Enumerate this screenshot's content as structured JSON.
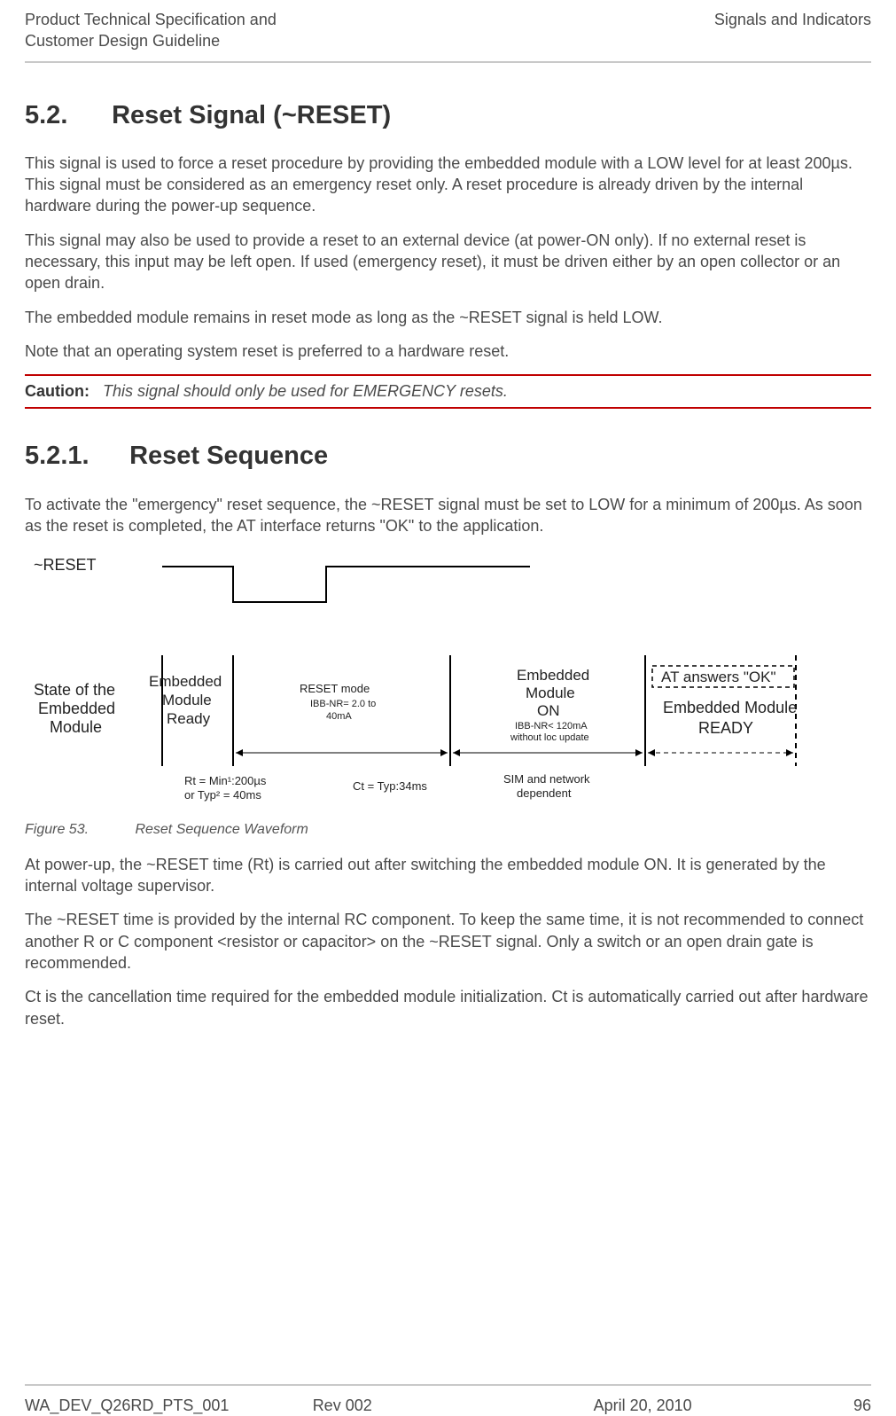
{
  "header": {
    "left_line1": "Product Technical Specification and",
    "left_line2": "Customer Design Guideline",
    "right": "Signals and Indicators"
  },
  "section": {
    "number": "5.2.",
    "title": "Reset Signal (~RESET)",
    "paragraphs": [
      "This signal is used to force a reset procedure by providing the embedded module with a LOW level for at least 200µs. This signal must be considered as an emergency reset only. A reset procedure is already driven by the internal hardware during the power-up sequence.",
      "This signal may also be used to provide a reset to an external device (at power-ON only). If no external reset is necessary, this input may be left open. If used (emergency reset), it must be driven either by an open collector or an open drain.",
      "The embedded module remains in reset mode as long as the ~RESET signal is held LOW.",
      "Note that an operating system reset is preferred to a hardware reset."
    ]
  },
  "caution": {
    "label": "Caution:",
    "text": "This signal should only be used for EMERGENCY resets."
  },
  "subsection": {
    "number": "5.2.1.",
    "title": "Reset Sequence",
    "intro": "To activate the \"emergency\" reset sequence, the ~RESET signal must be set to LOW for a minimum of 200µs. As soon as the reset is completed, the AT interface returns \"OK\" to the application."
  },
  "figure": {
    "number": "Figure 53.",
    "caption": "Reset Sequence Waveform",
    "labels": {
      "reset_signal": "~RESET",
      "state_label_l1": "State of the",
      "state_label_l2": "Embedded",
      "state_label_l3": "Module",
      "state1_l1": "Embedded",
      "state1_l2": "Module",
      "state1_l3": "Ready",
      "state2_l1": "RESET mode",
      "state2_l2": "IBB-NR= 2.0 to",
      "state2_l3": "40mA",
      "state3_l1": "Embedded",
      "state3_l2": "Module",
      "state3_l3": "ON",
      "state3_l4": "IBB-NR< 120mA",
      "state3_l5": "without loc update",
      "state4_l1": "AT answers \"OK\"",
      "state4_l2": "Embedded Module",
      "state4_l3": "READY",
      "rt_l1": "Rt = Min¹:200µs",
      "rt_l2": "or Typ² = 40ms",
      "ct": "Ct =  Typ:34ms",
      "sim_l1": "SIM and network",
      "sim_l2": "dependent"
    }
  },
  "after_figure": [
    "At power-up, the ~RESET time (Rt) is carried out after switching the embedded module ON. It is generated by the internal voltage supervisor.",
    "The ~RESET time is provided by the internal RC component. To keep the same time, it is not recommended to connect another R or C component <resistor or capacitor> on the ~RESET signal. Only a switch or an open drain gate is recommended.",
    "Ct is the cancellation time required for the embedded module initialization. Ct is automatically carried out after hardware reset."
  ],
  "footer": {
    "doc_id": "WA_DEV_Q26RD_PTS_001",
    "rev": "Rev 002",
    "date": "April 20, 2010",
    "page": "96"
  }
}
